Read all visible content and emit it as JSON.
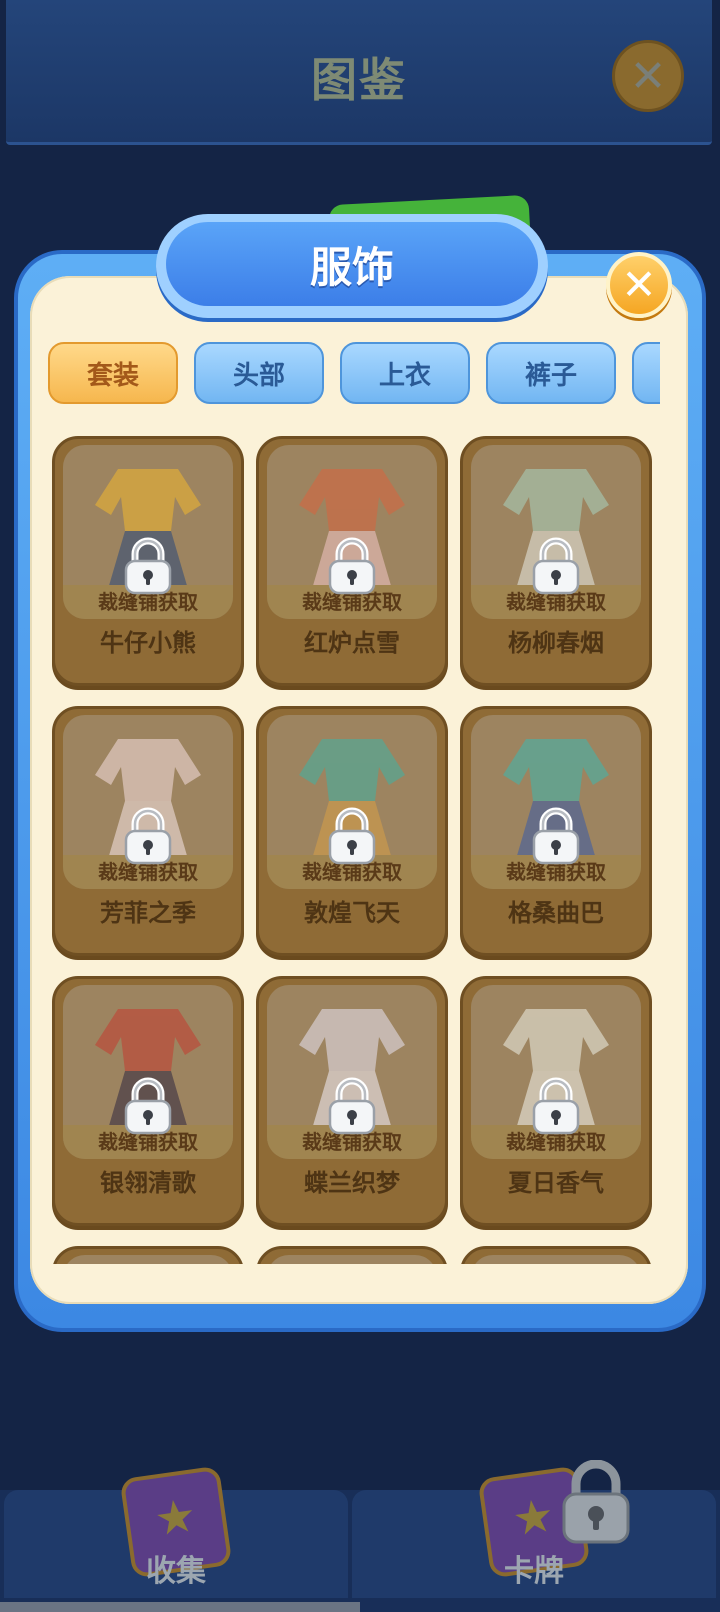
{
  "window": {
    "title": "图鉴"
  },
  "modal": {
    "title": "服饰"
  },
  "tabs": [
    {
      "label": "套装",
      "active": true
    },
    {
      "label": "头部",
      "active": false
    },
    {
      "label": "上衣",
      "active": false
    },
    {
      "label": "裤子",
      "active": false
    },
    {
      "label": "",
      "active": false
    }
  ],
  "items": [
    {
      "name": "牛仔小熊",
      "status": "裁缝铺获取",
      "locked": true,
      "colors": [
        "#f0b830",
        "#2a4a7a"
      ]
    },
    {
      "name": "红炉点雪",
      "status": "裁缝铺获取",
      "locked": true,
      "colors": [
        "#d8643e",
        "#f2c6c6"
      ]
    },
    {
      "name": "杨柳春烟",
      "status": "裁缝铺获取",
      "locked": true,
      "colors": [
        "#a8d4c0",
        "#e8ece4"
      ]
    },
    {
      "name": "芳菲之季",
      "status": "裁缝铺获取",
      "locked": true,
      "colors": [
        "#f4dede",
        "#f6e6e6"
      ]
    },
    {
      "name": "敦煌飞天",
      "status": "裁缝铺获取",
      "locked": true,
      "colors": [
        "#3fb2a4",
        "#d8a048"
      ]
    },
    {
      "name": "格桑曲巴",
      "status": "裁缝铺获取",
      "locked": true,
      "colors": [
        "#3cb8b0",
        "#3a5ca8"
      ]
    },
    {
      "name": "银翎清歌",
      "status": "裁缝铺获取",
      "locked": true,
      "colors": [
        "#c43c30",
        "#302840"
      ]
    },
    {
      "name": "蝶兰织梦",
      "status": "裁缝铺获取",
      "locked": true,
      "colors": [
        "#e8e4f2",
        "#f2eef8"
      ]
    },
    {
      "name": "夏日香气",
      "status": "裁缝铺获取",
      "locked": true,
      "colors": [
        "#eef0e6",
        "#f4f4ec"
      ]
    },
    {
      "name": "",
      "status": "",
      "locked": true,
      "colors": [
        "#9d8460",
        "#9d8460"
      ]
    },
    {
      "name": "",
      "status": "",
      "locked": true,
      "colors": [
        "#9d8460",
        "#9d8460"
      ]
    },
    {
      "name": "",
      "status": "",
      "locked": true,
      "colors": [
        "#9d8460",
        "#9d8460"
      ]
    }
  ],
  "bottom_nav": [
    {
      "label": "收集",
      "active": true
    },
    {
      "label": "卡牌",
      "active": false,
      "locked": true
    }
  ]
}
